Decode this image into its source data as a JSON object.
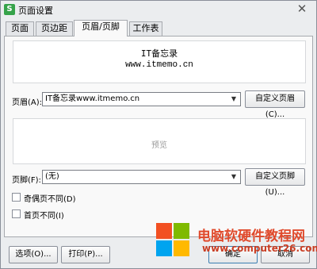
{
  "window": {
    "title": "页面设置",
    "app_icon_glyph": "S",
    "close_glyph": "✕"
  },
  "tabs": [
    {
      "label": "页面",
      "active": false
    },
    {
      "label": "页边距",
      "active": false
    },
    {
      "label": "页眉/页脚",
      "active": true
    },
    {
      "label": "工作表",
      "active": false
    }
  ],
  "header_preview": {
    "line1": "IT备忘录",
    "line2": "www.itmemo.cn"
  },
  "header": {
    "label": "页眉(A):",
    "value": "IT备忘录www.itmemo.cn",
    "custom_button": "自定义页眉(C)..."
  },
  "middle_preview": {
    "label": "预览"
  },
  "footer": {
    "label": "页脚(F):",
    "value": "(无)",
    "custom_button": "自定义页脚(U)..."
  },
  "checkboxes": [
    {
      "label": "奇偶页不同(D)",
      "checked": false
    },
    {
      "label": "首页不同(I)",
      "checked": false
    }
  ],
  "buttons": {
    "options": "选项(O)...",
    "print": "打印(P)...",
    "ok": "确定",
    "cancel": "取消"
  },
  "watermark": {
    "text1": "电脑软硬件教程网",
    "text2": "www.computer26.com"
  },
  "icons": {
    "dropdown_arrow": "▼"
  }
}
